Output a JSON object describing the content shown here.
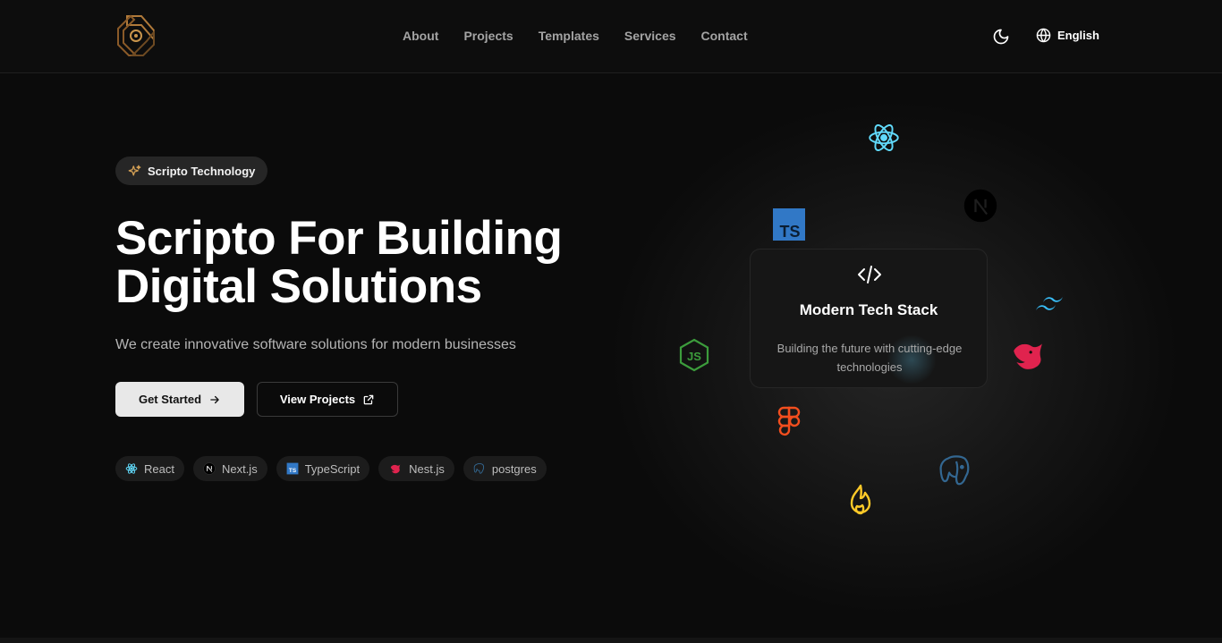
{
  "nav": {
    "items": [
      "About",
      "Projects",
      "Templates",
      "Services",
      "Contact"
    ],
    "language": "English"
  },
  "hero": {
    "badge": "Scripto Technology",
    "title_line1": "Scripto For Building",
    "title_line2": "Digital Solutions",
    "subtitle": "We create innovative software solutions for modern businesses",
    "primary_button": "Get Started",
    "secondary_button": "View Projects",
    "chips": [
      "React",
      "Next.js",
      "TypeScript",
      "Nest.js",
      "postgres"
    ]
  },
  "card": {
    "title": "Modern Tech Stack",
    "description": "Building the future with cutting-edge technologies"
  },
  "orbit_icons": [
    "react-icon",
    "nextjs-icon",
    "typescript-icon",
    "tailwind-icon",
    "nestjs-icon",
    "nodejs-icon",
    "figma-icon",
    "postgres-icon",
    "firebase-icon"
  ],
  "colors": {
    "background": "#0b0b0b",
    "react": "#61dafb",
    "typescript": "#3178c6",
    "tailwind": "#38bdf8",
    "nestjs": "#e0234e",
    "nodejs": "#3c9c3c",
    "figma": "#f24e1e",
    "postgres": "#336791",
    "firebase": "#ffca28",
    "badge_star": "#d4a055"
  }
}
